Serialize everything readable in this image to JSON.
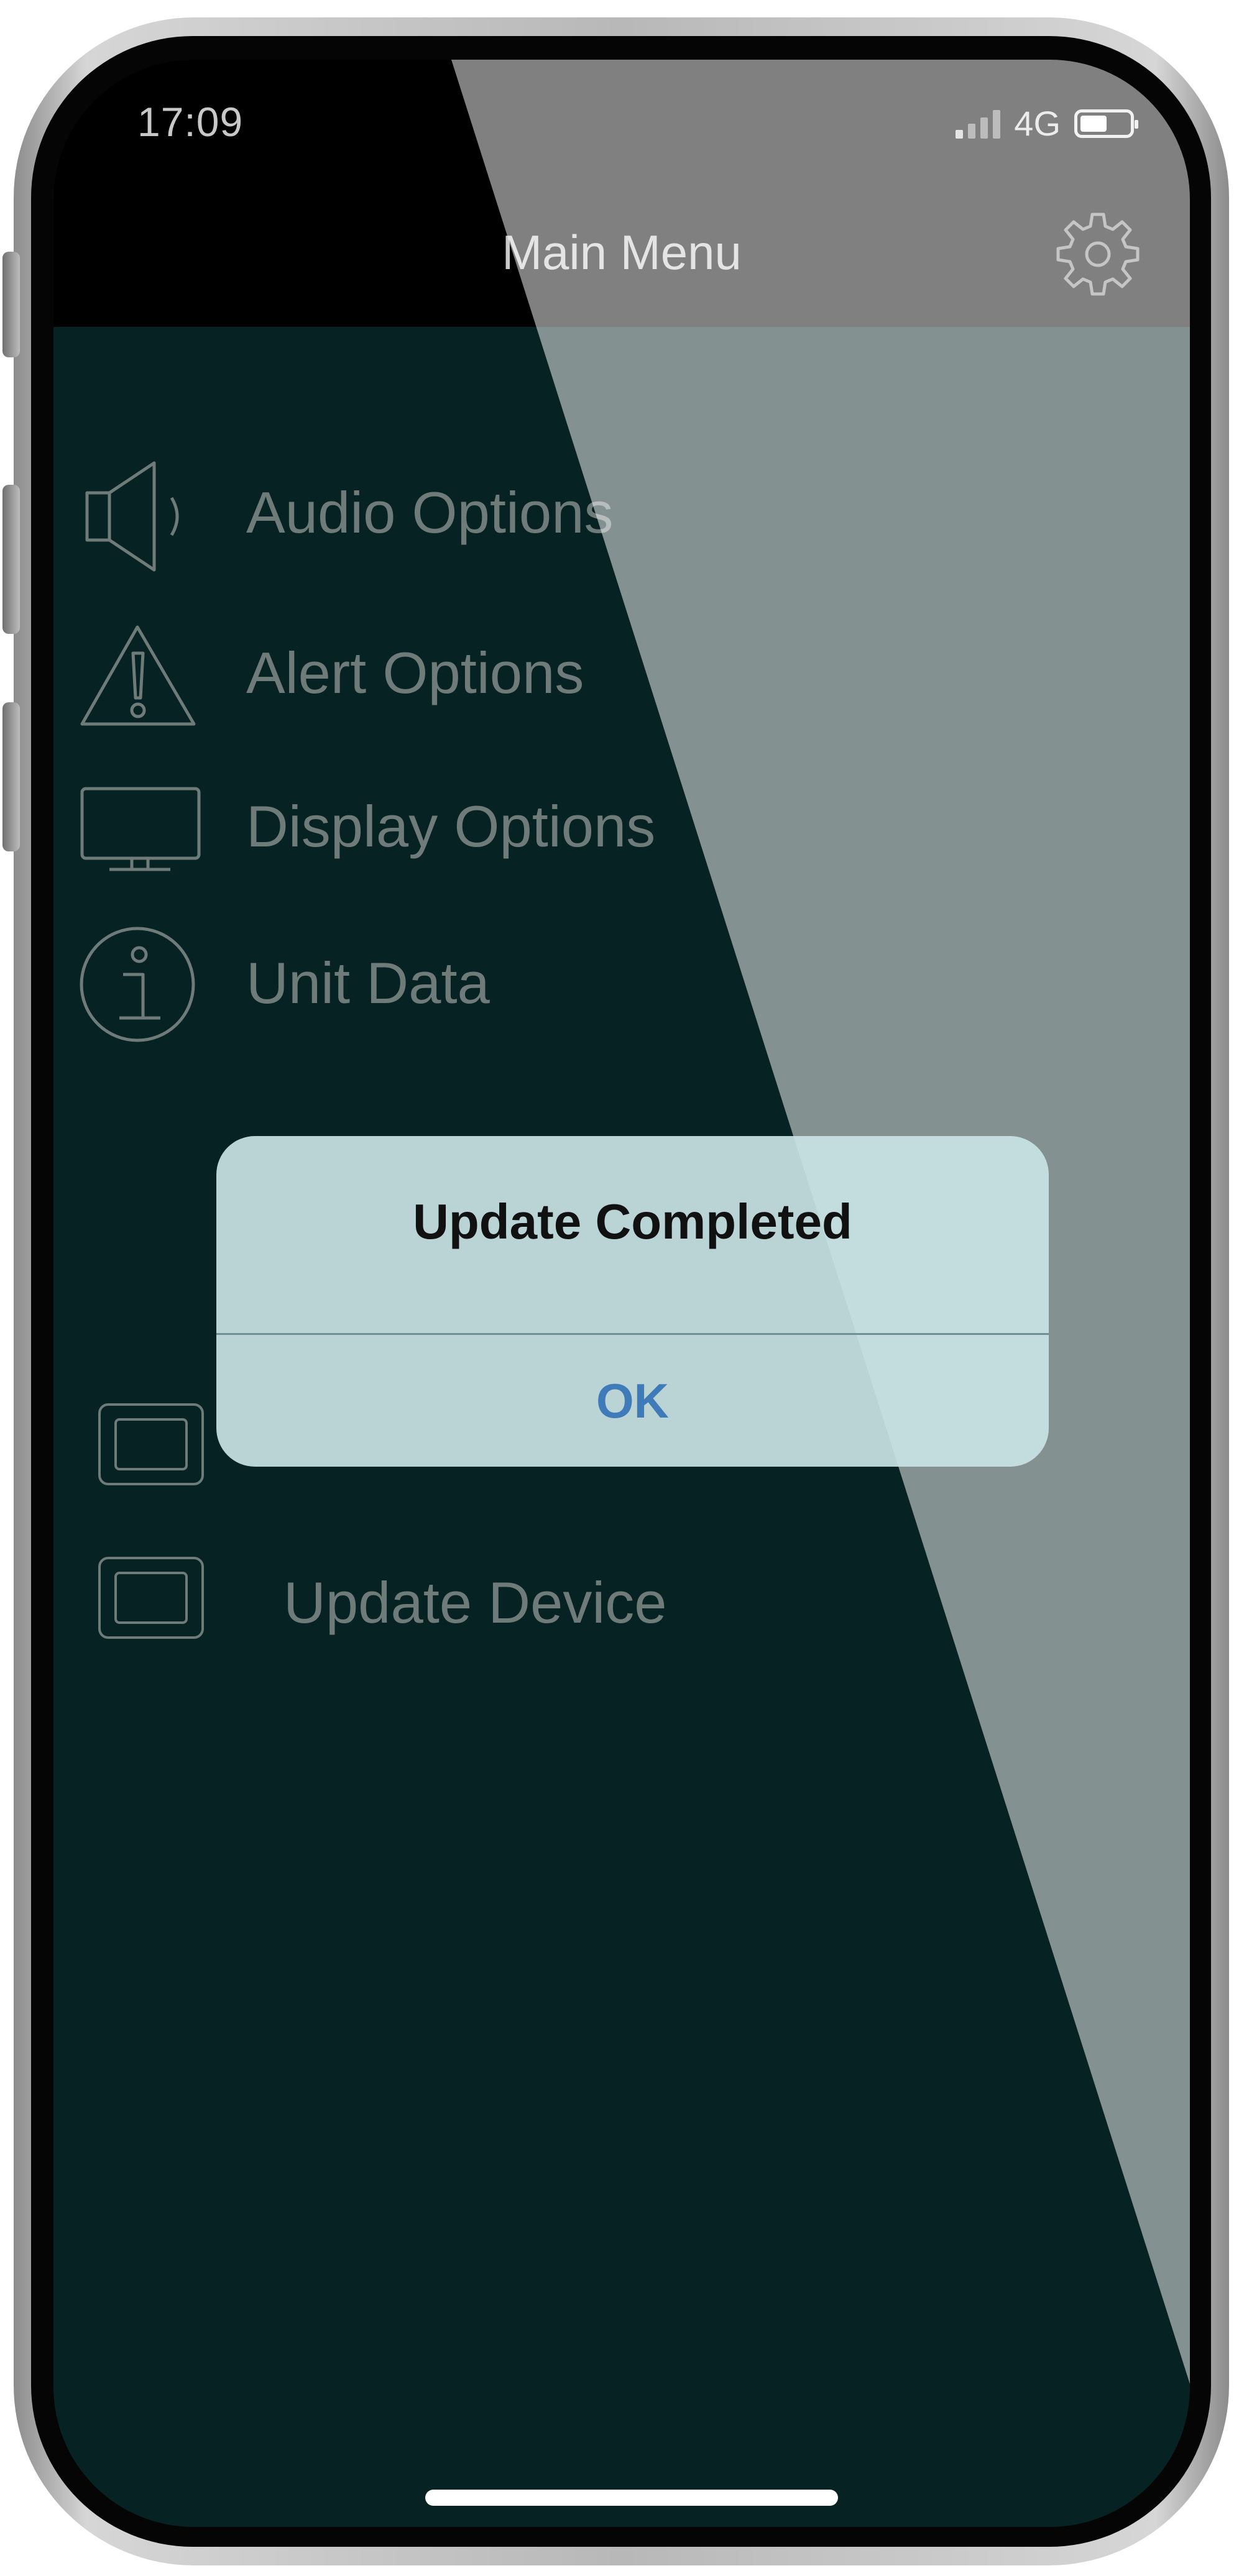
{
  "status_bar": {
    "time": "17:09",
    "network": "4G",
    "signal_bars": 4,
    "signal_active_bars": 1
  },
  "nav": {
    "title": "Main Menu",
    "settings_icon": "gear-icon"
  },
  "menu": {
    "items": [
      {
        "label": "Audio Options",
        "icon": "speaker-icon"
      },
      {
        "label": "Alert Options",
        "icon": "warning-icon"
      },
      {
        "label": "Display Options",
        "icon": "monitor-icon"
      },
      {
        "label": "Unit Data",
        "icon": "info-icon"
      }
    ]
  },
  "devices": {
    "items": [
      {
        "label": "",
        "icon": "device-icon"
      },
      {
        "label": "Update Device",
        "icon": "device-icon"
      }
    ]
  },
  "alert": {
    "title": "Update Completed",
    "ok_label": "OK"
  },
  "colors": {
    "background": "#072223",
    "navbar": "#000000",
    "alert_background": "#c8e2e4",
    "alert_button": "#3f7bb9",
    "menu_text": "#6e7b79"
  }
}
